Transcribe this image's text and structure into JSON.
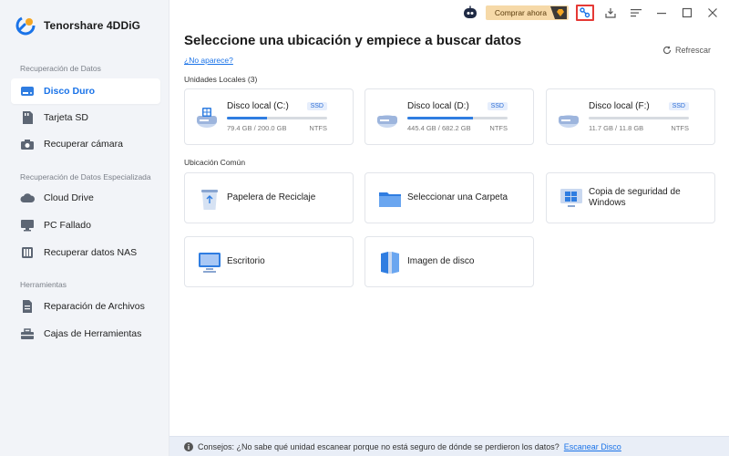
{
  "app": {
    "name": "Tenorshare 4DDiG"
  },
  "topbar": {
    "buy_label": "Comprar ahora"
  },
  "sidebar": {
    "sections": [
      {
        "title": "Recuperación de Datos"
      },
      {
        "title": "Recuperación de Datos Especializada"
      },
      {
        "title": "Herramientas"
      }
    ],
    "items": [
      {
        "label": "Disco Duro",
        "icon": "hard-drive-icon",
        "active": true
      },
      {
        "label": "Tarjeta SD",
        "icon": "sd-card-icon"
      },
      {
        "label": "Recuperar cámara",
        "icon": "camera-icon"
      },
      {
        "label": "Cloud Drive",
        "icon": "cloud-icon"
      },
      {
        "label": "PC Fallado",
        "icon": "crashed-pc-icon"
      },
      {
        "label": "Recuperar datos NAS",
        "icon": "nas-icon"
      },
      {
        "label": "Reparación de Archivos",
        "icon": "file-repair-icon"
      },
      {
        "label": "Cajas de Herramientas",
        "icon": "toolbox-icon"
      }
    ]
  },
  "main": {
    "title": "Seleccione una ubicación y empiece a buscar datos",
    "no_appear": "¿No aparece?",
    "refresh": "Refrescar",
    "local_units_label": "Unidades Locales (3)",
    "common_label": "Ubicación Común",
    "drives": [
      {
        "name": "Disco local (C:)",
        "badge": "SSD",
        "size": "79.4 GB / 200.0 GB",
        "fs": "NTFS",
        "used_percent": 39.7
      },
      {
        "name": "Disco local (D:)",
        "badge": "SSD",
        "size": "445.4 GB / 682.2 GB",
        "fs": "NTFS",
        "used_percent": 65.3
      },
      {
        "name": "Disco local (F:)",
        "badge": "SSD",
        "size": "11.7 GB / 11.8 GB",
        "fs": "NTFS",
        "used_percent": 0
      }
    ],
    "locations": [
      {
        "label": "Papelera de Reciclaje",
        "icon": "recycle-bin-icon"
      },
      {
        "label": "Seleccionar una Carpeta",
        "icon": "folder-icon"
      },
      {
        "label": "Copia de seguridad de Windows",
        "icon": "windows-backup-icon"
      },
      {
        "label": "Escritorio",
        "icon": "desktop-icon"
      },
      {
        "label": "Imagen de disco",
        "icon": "disk-image-icon"
      }
    ]
  },
  "footer": {
    "tip": "Consejos: ¿No sabe qué unidad escanear porque no está seguro de dónde se perdieron los datos?",
    "link": "Escanear Disco"
  },
  "colors": {
    "accent": "#1a73e8",
    "sidebar_bg": "#f2f4f8",
    "buy_bg": "#f6d9a8",
    "highlight": "#e53935"
  }
}
